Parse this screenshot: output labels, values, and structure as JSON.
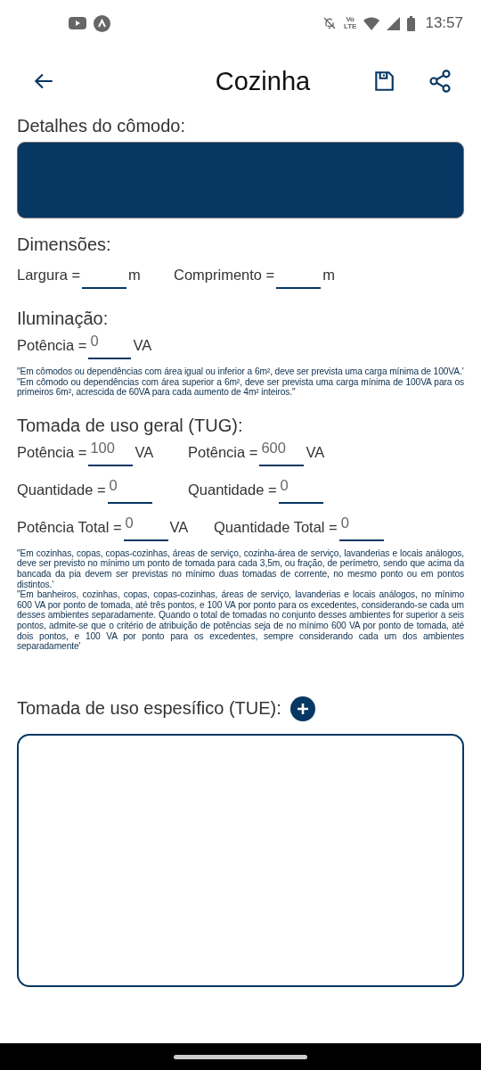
{
  "status_bar": {
    "time": "13:57",
    "volte": [
      "Vo",
      "LTE"
    ]
  },
  "app_bar": {
    "title": "Cozinha"
  },
  "details": {
    "label": "Detalhes do cômodo:"
  },
  "dimensions": {
    "heading": "Dimensões:",
    "fields": [
      {
        "label": "Largura =",
        "unit": "m"
      },
      {
        "label": "Comprimento =",
        "unit": "m"
      }
    ]
  },
  "lighting": {
    "heading": "Iluminação:",
    "fields": [
      {
        "label": "Potência =",
        "value": "0",
        "unit": "VA"
      }
    ],
    "notes": [
      "\"Em cômodos ou dependências com área igual ou inferior a 6m², deve ser prevista uma carga mínima de 100VA.'",
      "\"Em cômodo ou dependências com área superior a 6m², deve ser prevista uma carga mínima de 100VA para os primeiros 6m², acrescida de 60VA para cada aumento de 4m² inteiros.\""
    ]
  },
  "tug": {
    "heading": "Tomada de uso geral (TUG):",
    "rows": [
      [
        {
          "label": "Potência =",
          "value": "100",
          "unit": "VA"
        },
        {
          "label": "Potência =",
          "value": "600",
          "unit": "VA"
        }
      ],
      [
        {
          "label": "Quantidade =",
          "value": "0"
        },
        {
          "label": "Quantidade =",
          "value": "0"
        }
      ],
      [
        {
          "label": "Potência Total =",
          "value": "0",
          "unit": "VA"
        },
        {
          "label": "Quantidade Total =",
          "value": "0"
        }
      ]
    ],
    "notes": [
      "\"Em cozinhas, copas, copas-cozinhas, áreas de serviço, cozinha-área de serviço, lavanderias e locais análogos, deve ser previsto no mínimo um ponto de tomada para cada 3,5m, ou fração, de perímetro, sendo que acima da bancada da pia devem ser previstas no mínimo duas tomadas de corrente, no mesmo ponto ou em pontos distintos.'",
      "\"Em banheiros, cozinhas, copas, copas-cozinhas, áreas de serviço, lavanderias e locais análogos, no mínimo 600 VA por ponto de tomada, até três pontos, e 100 VA por ponto para os excedentes, considerando-se cada um desses ambientes separadamente. Quando o total de tomadas no conjunto desses ambientes for superior a seis pontos, admite-se que o critério de atribuição de potências seja de no mínimo 600 VA por ponto de tomada, até dois pontos, e 100 VA por ponto para os excedentes, sempre considerando cada um dos ambientes separadamente'"
    ]
  },
  "tue": {
    "heading": "Tomada de uso espesífico (TUE):"
  }
}
